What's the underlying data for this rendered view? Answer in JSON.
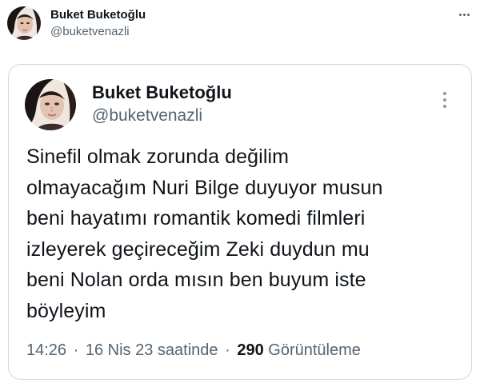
{
  "outer_tweet": {
    "display_name": "Buket Buketoğlu",
    "handle": "@buketvenazli"
  },
  "quoted_card": {
    "display_name": "Buket Buketoğlu",
    "handle": "@buketvenazli",
    "text_lines": [
      "Sinefil olmak zorunda değilim",
      "olmayacağım Nuri Bilge duyuyor musun",
      "beni hayatımı romantik komedi filmleri",
      "izleyerek geçireceğim Zeki duydun mu",
      "beni Nolan orda mısın ben buyum iste",
      "böyleyim"
    ],
    "time": "14:26",
    "date": "16 Nis 23 saatinde",
    "separator": "·",
    "views_count": "290",
    "views_label": "Görüntüleme"
  },
  "icons": {
    "outer_more": "more-horizontal-icon",
    "card_more": "more-vertical-icon"
  },
  "colors": {
    "text_primary": "#0f1419",
    "text_secondary": "#536471",
    "card_border": "#cfd9de"
  }
}
